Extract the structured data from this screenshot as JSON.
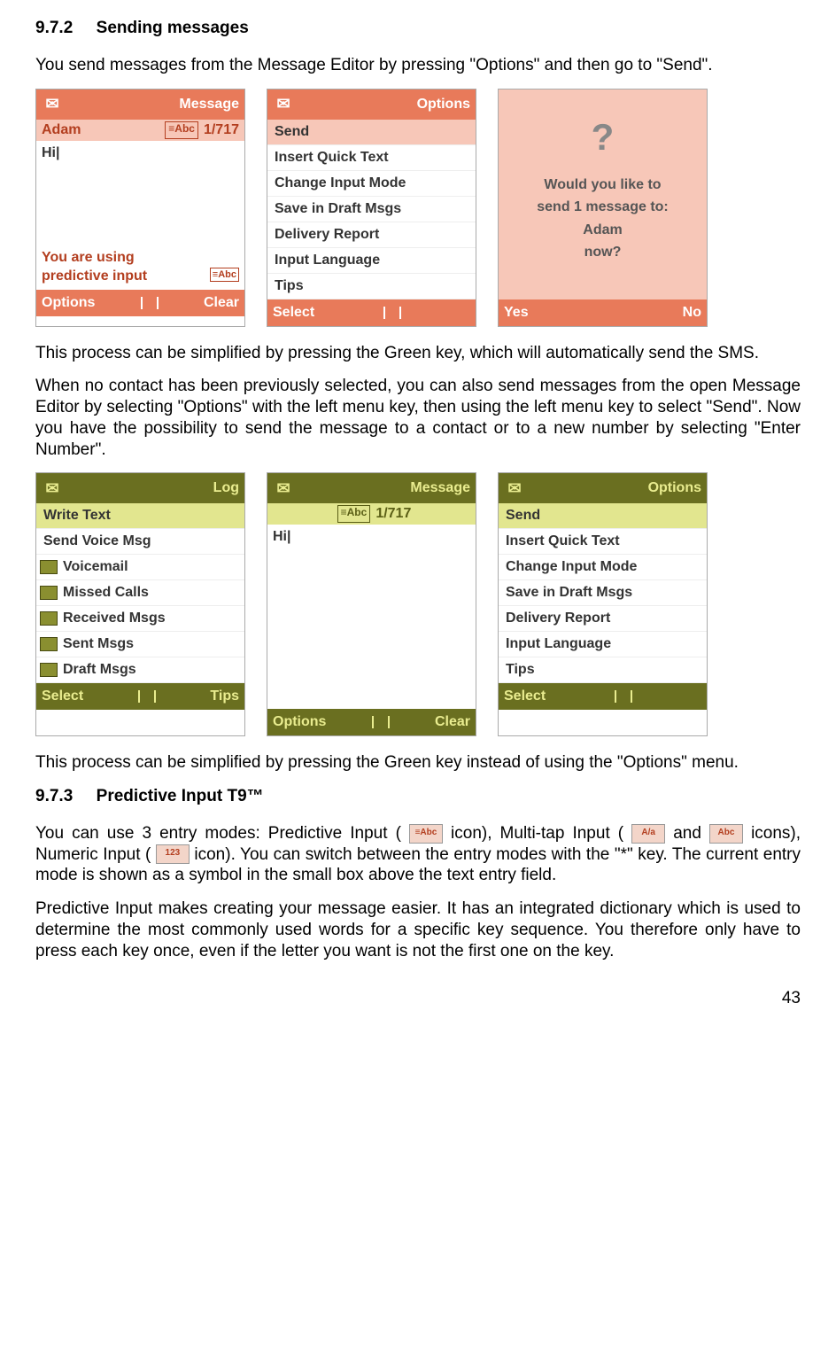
{
  "section1": {
    "num": "9.7.2",
    "title": "Sending messages"
  },
  "para1": "You send messages from the Message Editor by pressing \"Options\" and then go to \"Send\".",
  "row1": {
    "s1": {
      "title": "Message",
      "recipient": "Adam",
      "badge": "≡Abc",
      "counter": "1/717",
      "body": "Hi|",
      "hint_l1": "You are using",
      "hint_l2": "predictive input",
      "soft_left": "Options",
      "soft_right": "Clear"
    },
    "s2": {
      "title": "Options",
      "items": [
        "Send",
        "Insert Quick Text",
        "Change Input Mode",
        "Save in Draft Msgs",
        "Delivery Report",
        "Input Language",
        "Tips"
      ],
      "soft_left": "Select"
    },
    "s3": {
      "q_l1": "Would you like to",
      "q_l2": "send 1 message to:",
      "q_l3": "Adam",
      "q_l4": "now?",
      "soft_left": "Yes",
      "soft_right": "No"
    }
  },
  "para2": "This process can be simplified by pressing the Green key, which will automatically send the SMS.",
  "para3": "When no contact has been previously selected, you can also send messages from the open Message Editor by selecting \"Options\" with the left menu key, then using the left menu key to select \"Send\". Now you have the possibility to send the message to a contact or to a new number by selecting \"Enter Number\".",
  "row2": {
    "s1": {
      "title": "Log",
      "items": [
        "Write Text",
        "Send Voice Msg",
        "Voicemail",
        "Missed Calls",
        "Received Msgs",
        "Sent Msgs",
        "Draft Msgs"
      ],
      "soft_left": "Select",
      "soft_right": "Tips"
    },
    "s2": {
      "title": "Message",
      "badge": "≡Abc",
      "counter": "1/717",
      "body": "Hi|",
      "soft_left": "Options",
      "soft_right": "Clear"
    },
    "s3": {
      "title": "Options",
      "items": [
        "Send",
        "Insert Quick Text",
        "Change Input Mode",
        "Save in Draft Msgs",
        "Delivery Report",
        "Input Language",
        "Tips"
      ],
      "soft_left": "Select"
    }
  },
  "para4": "This process can be simplified by pressing the Green key instead of using the \"Options\" menu.",
  "section2": {
    "num": "9.7.3",
    "title": "Predictive Input T9™"
  },
  "para5_a": "You can use 3 entry modes: Predictive Input (",
  "para5_b": " icon), Multi-tap Input (",
  "para5_c": " and ",
  "para5_d": " icons), Numeric Input (",
  "para5_e": " icon). You can switch between the entry modes with the \"*\" key. The current entry mode is shown as a symbol in the small box above the text entry field.",
  "para6": "Predictive Input makes creating your message easier. It has an integrated dictionary which is used to determine the most commonly used words for a specific key sequence. You therefore only have to press each key once, even if the letter you want is not the first one on the key.",
  "icons": {
    "predictive": "≡Abc",
    "multitap1": "A/a",
    "multitap2": "Abc",
    "numeric": "123"
  },
  "page_number": "43"
}
